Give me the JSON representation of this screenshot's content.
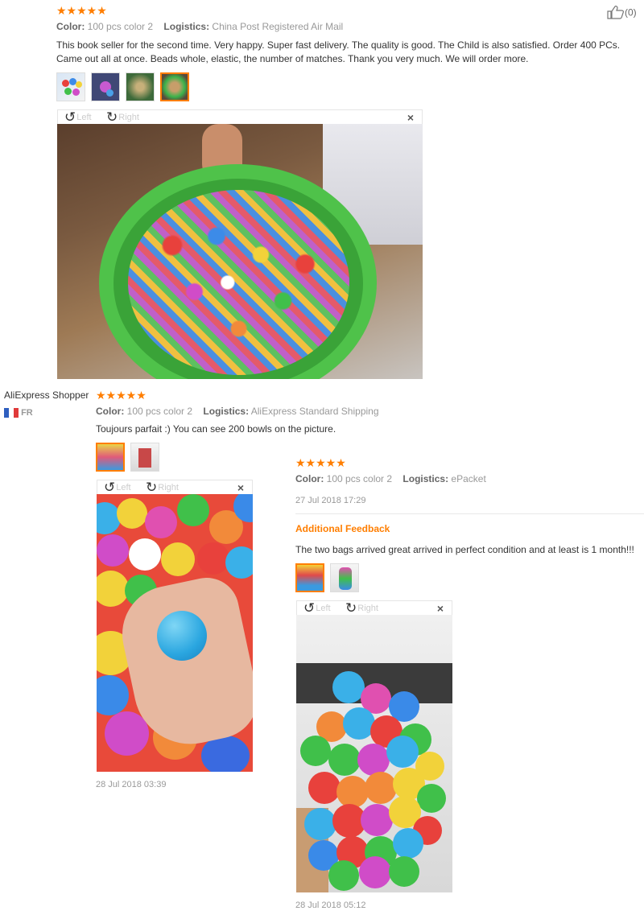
{
  "review1": {
    "stars": "★★★★★",
    "color_label": "Color:",
    "color_value": "100 pcs color 2",
    "logistics_label": "Logistics:",
    "logistics_value": "China Post Registered Air Mail",
    "text": "This book seller for the second time. Very happy. Super fast delivery. The quality is good. The Child is also satisfied. Order 400 PCs. Came out all at once. Beads whole, elastic, the number of matches. Thank you very much. We will order more.",
    "like_count": "(0)",
    "viewer": {
      "left": "Left",
      "right": "Right",
      "close": "×"
    }
  },
  "review2": {
    "author": "AliExpress Shopper",
    "country": "FR",
    "stars": "★★★★★",
    "color_label": "Color:",
    "color_value": "100 pcs color 2",
    "logistics_label": "Logistics:",
    "logistics_value": "AliExpress Standard Shipping",
    "text": "Toujours parfait :) You can see 200 bowls on the picture.",
    "date": "28 Jul 2018 03:39",
    "viewer": {
      "left": "Left",
      "right": "Right",
      "close": "×"
    }
  },
  "review3": {
    "stars": "★★★★★",
    "color_label": "Color:",
    "color_value": "100 pcs color 2",
    "logistics_label": "Logistics:",
    "logistics_value": "ePacket",
    "date": "27 Jul 2018 17:29",
    "additional_title": "Additional Feedback",
    "additional_text": "The two bags arrived great arrived in perfect condition and at least is 1 month!!!",
    "additional_date": "28 Jul 2018 05:12",
    "viewer": {
      "left": "Left",
      "right": "Right",
      "close": "×"
    }
  },
  "colors": {
    "accent": "#ff7e00",
    "meta": "#999999",
    "text": "#333333"
  },
  "icons": {
    "rotate_left": "rotate-left-icon",
    "rotate_right": "rotate-right-icon",
    "like": "thumbs-up-icon",
    "close": "close-icon"
  }
}
